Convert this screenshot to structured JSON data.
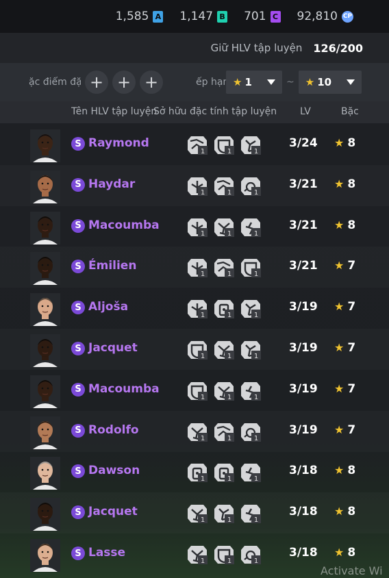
{
  "currencies": [
    {
      "amount": "1,585",
      "icon": "A"
    },
    {
      "amount": "1,147",
      "icon": "B"
    },
    {
      "amount": "701",
      "icon": "C"
    },
    {
      "amount": "92,810",
      "icon": "CP"
    }
  ],
  "capacity": {
    "label": "Giữ HLV tập luyện",
    "value": "126/200"
  },
  "filters": {
    "trait_label": "ặc điểm đặ",
    "rank_label": "ếp hạn",
    "min": {
      "star": "★",
      "value": "1"
    },
    "separator": "~",
    "max": {
      "star": "★",
      "value": "10"
    }
  },
  "columns": {
    "name": "Tên HLV tập luyện",
    "traits": "Sở hữu đặc tính tập luyện",
    "lv": "LV",
    "rank": "Bặc"
  },
  "rows": [
    {
      "name": "Raymond",
      "lv": "3/24",
      "rank": "8",
      "traits": [
        {
          "icon": "passing-trait-icon",
          "level": "1"
        },
        {
          "icon": "shield-trait-icon",
          "level": "1"
        },
        {
          "icon": "kick-trait-icon",
          "level": "1"
        }
      ]
    },
    {
      "name": "Haydar",
      "lv": "3/21",
      "rank": "8",
      "traits": [
        {
          "icon": "target-trait-icon",
          "level": "1"
        },
        {
          "icon": "passing-trait-icon",
          "level": "1"
        },
        {
          "icon": "dribble-trait-icon",
          "level": "1"
        }
      ]
    },
    {
      "name": "Macoumba",
      "lv": "3/21",
      "rank": "8",
      "traits": [
        {
          "icon": "target-trait-icon",
          "level": "1"
        },
        {
          "icon": "tackle-trait-icon",
          "level": "1"
        },
        {
          "icon": "sprint-trait-icon",
          "level": "1"
        }
      ]
    },
    {
      "name": "Émilien",
      "lv": "3/21",
      "rank": "7",
      "traits": [
        {
          "icon": "target-trait-icon",
          "level": "1"
        },
        {
          "icon": "passing-trait-icon",
          "level": "1"
        },
        {
          "icon": "shield-trait-icon",
          "level": "1"
        }
      ]
    },
    {
      "name": "Aljoša",
      "lv": "3/19",
      "rank": "7",
      "traits": [
        {
          "icon": "target-trait-icon",
          "level": "1"
        },
        {
          "icon": "keeper-trait-icon",
          "level": "1"
        },
        {
          "icon": "kick-trait-icon",
          "level": "1"
        }
      ]
    },
    {
      "name": "Jacquet",
      "lv": "3/19",
      "rank": "7",
      "traits": [
        {
          "icon": "shield-trait-icon",
          "level": "1"
        },
        {
          "icon": "tackle-trait-icon",
          "level": "1"
        },
        {
          "icon": "kick-trait-icon",
          "level": "1"
        }
      ]
    },
    {
      "name": "Macoumba",
      "lv": "3/19",
      "rank": "7",
      "traits": [
        {
          "icon": "shield-trait-icon",
          "level": "1"
        },
        {
          "icon": "tackle-trait-icon",
          "level": "1"
        },
        {
          "icon": "sprint-trait-icon",
          "level": "1"
        }
      ]
    },
    {
      "name": "Rodolfo",
      "lv": "3/19",
      "rank": "7",
      "traits": [
        {
          "icon": "tackle-trait-icon",
          "level": "1"
        },
        {
          "icon": "passing-trait-icon",
          "level": "1"
        },
        {
          "icon": "dribble-trait-icon",
          "level": "1"
        }
      ]
    },
    {
      "name": "Dawson",
      "lv": "3/18",
      "rank": "8",
      "traits": [
        {
          "icon": "keeper-trait-icon",
          "level": "1"
        },
        {
          "icon": "keeper-trait-icon",
          "level": "1"
        },
        {
          "icon": "sprint-trait-icon",
          "level": "1"
        }
      ]
    },
    {
      "name": "Jacquet",
      "lv": "3/18",
      "rank": "8",
      "traits": [
        {
          "icon": "tackle-trait-icon",
          "level": "1"
        },
        {
          "icon": "kick-trait-icon",
          "level": "1"
        },
        {
          "icon": "sprint-trait-icon",
          "level": "1"
        }
      ]
    },
    {
      "name": "Lasse",
      "lv": "3/18",
      "rank": "8",
      "traits": [
        {
          "icon": "tackle-trait-icon",
          "level": "1"
        },
        {
          "icon": "shield-trait-icon",
          "level": "1"
        },
        {
          "icon": "dribble-trait-icon",
          "level": "1"
        }
      ]
    }
  ],
  "badge_letter": "S",
  "rank_star": "★",
  "watermark": "Activate Wi",
  "colors": {
    "name": "#b677f0",
    "badge": "#7b4ad8",
    "star": "#f0c330",
    "currency_a": "#3fa2e6",
    "currency_b": "#1fd1b0",
    "currency_c": "#a44cf0",
    "currency_cp": "#6ea4ff"
  }
}
